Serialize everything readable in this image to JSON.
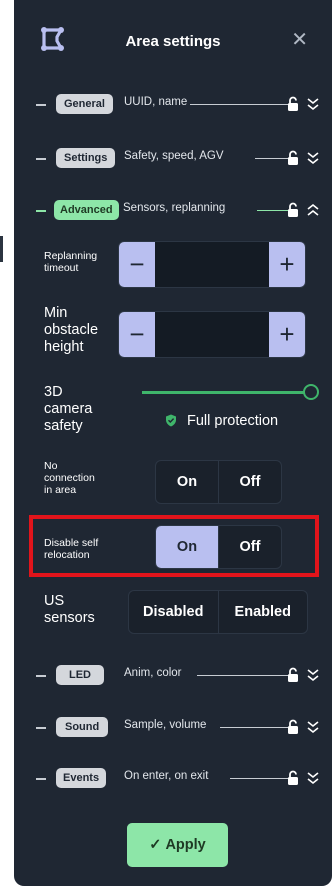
{
  "header": {
    "title": "Area settings",
    "close_icon": "close-icon",
    "logo_icon": "area-logo-icon"
  },
  "sections": [
    {
      "id": "general",
      "label": "General",
      "desc": "UUID, name",
      "active": false,
      "expanded": false
    },
    {
      "id": "settings",
      "label": "Settings",
      "desc": "Safety, speed, AGV",
      "active": false,
      "expanded": false
    },
    {
      "id": "advanced",
      "label": "Advanced",
      "desc": "Sensors, replanning",
      "active": true,
      "expanded": true
    },
    {
      "id": "led",
      "label": "LED",
      "desc": "Anim, color",
      "active": false,
      "expanded": false
    },
    {
      "id": "sound",
      "label": "Sound",
      "desc": "Sample, volume",
      "active": false,
      "expanded": false
    },
    {
      "id": "events",
      "label": "Events",
      "desc": "On enter, on exit",
      "active": false,
      "expanded": false
    }
  ],
  "advanced": {
    "replanning": {
      "label": "Replanning\ntimeout",
      "minus": "−",
      "plus": "+",
      "value": ""
    },
    "obstacle": {
      "label": "Min\nobstacle\nheight",
      "minus": "−",
      "plus": "+",
      "value": ""
    },
    "camera": {
      "label": "3D\ncamera\nsafety",
      "level": 1.0,
      "status": "Full protection"
    },
    "no_connection": {
      "label": "No\nconnection\nin area",
      "on": "On",
      "off": "Off",
      "selected": "none"
    },
    "self_relocation": {
      "label": "Disable self\nrelocation",
      "on": "On",
      "off": "Off",
      "selected": "on"
    },
    "us_sensors": {
      "label": "US\nsensors",
      "disabled": "Disabled",
      "enabled": "Enabled",
      "selected": "none"
    }
  },
  "apply": {
    "label": "Apply"
  },
  "colors": {
    "panel": "#1f2733",
    "accent_green": "#8de6a8",
    "accent_purple": "#b9bff0",
    "highlight_red": "#e1141b"
  }
}
